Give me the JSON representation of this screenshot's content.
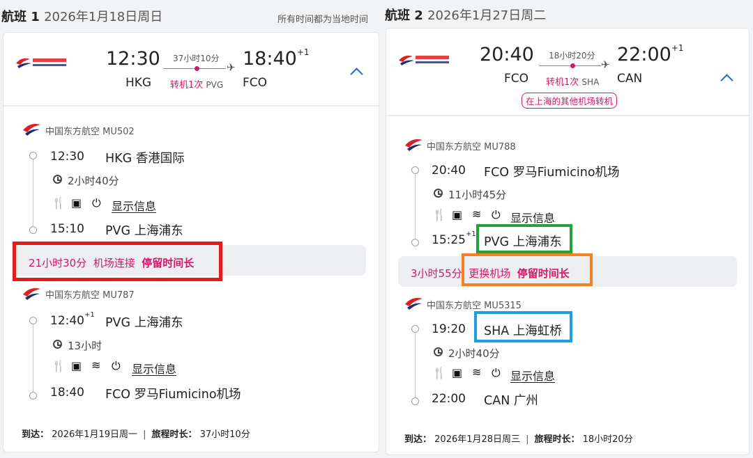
{
  "colors": {
    "accent_pink": "#d4166a",
    "chevron_blue": "#1a6ec8",
    "box_red": "#e01e1e",
    "box_green": "#22a33a",
    "box_orange": "#f58220",
    "box_blue": "#1ea0e0",
    "airline_red": "#e02020",
    "airline_navy": "#1c2a6e"
  },
  "timezone_note": "所有时间都为当地时间",
  "flights": [
    {
      "title": "航班 1",
      "date": "2026年1月18日周日",
      "summary": {
        "depart_time": "12:30",
        "arrive_time": "18:40",
        "arrive_day_offset": "+1",
        "depart_code": "HKG",
        "arrive_code": "FCO",
        "duration": "37小时10分",
        "stops": "转机1次",
        "via": "PVG"
      },
      "segments": [
        {
          "airline": "中国东方航空 MU502",
          "depart_time": "12:30",
          "depart_airport": "HKG 香港国际",
          "duration": "2小时40分",
          "amenities": [
            "meal-icon",
            "screen-icon",
            "power-icon"
          ],
          "show_info": "显示信息",
          "arrive_time": "15:10",
          "arrive_airport": "PVG 上海浦东"
        },
        {
          "airline": "中国东方航空 MU787",
          "depart_time": "12:40",
          "depart_day_offset": "+1",
          "depart_airport": "PVG 上海浦东",
          "duration": "13小时",
          "amenities": [
            "meal-icon",
            "screen-icon",
            "wifi-icon",
            "power-icon"
          ],
          "show_info": "显示信息",
          "arrive_time": "18:40",
          "arrive_airport": "FCO 罗马Fiumicino机场"
        }
      ],
      "layover": {
        "duration": "21小时30分",
        "type": "机场连接",
        "warning": "停留时间长"
      },
      "footer": {
        "arrive_label": "到达：",
        "arrive_date": "2026年1月19日周一",
        "total_label": "旅程时长：",
        "total": "37小时10分"
      }
    },
    {
      "title": "航班 2",
      "date": "2026年1月27日周二",
      "summary": {
        "depart_time": "20:40",
        "arrive_time": "22:00",
        "arrive_day_offset": "+1",
        "depart_code": "FCO",
        "arrive_code": "CAN",
        "duration": "18小时20分",
        "stops": "转机1次",
        "via": "SHA",
        "warning": "在上海的其他机场转机"
      },
      "segments": [
        {
          "airline": "中国东方航空 MU788",
          "depart_time": "20:40",
          "depart_airport": "FCO 罗马Fiumicino机场",
          "duration": "11小时45分",
          "amenities": [
            "meal-icon",
            "screen-icon",
            "wifi-icon",
            "power-icon"
          ],
          "show_info": "显示信息",
          "arrive_time": "15:25",
          "arrive_day_offset": "+1",
          "arrive_airport": "PVG 上海浦东"
        },
        {
          "airline": "中国东方航空 MU5315",
          "depart_time": "19:20",
          "depart_airport": "SHA 上海虹桥",
          "duration": "2小时40分",
          "amenities": [
            "meal-icon",
            "screen-icon",
            "wifi-icon",
            "power-icon"
          ],
          "show_info": "显示信息",
          "arrive_time": "22:00",
          "arrive_airport": "CAN 广州"
        }
      ],
      "layover": {
        "duration": "3小时55分",
        "type": "更换机场",
        "warning": "停留时间长"
      },
      "footer": {
        "arrive_label": "到达：",
        "arrive_date": "2026年1月28日周三",
        "total_label": "旅程时长：",
        "total": "18小时20分"
      }
    }
  ]
}
